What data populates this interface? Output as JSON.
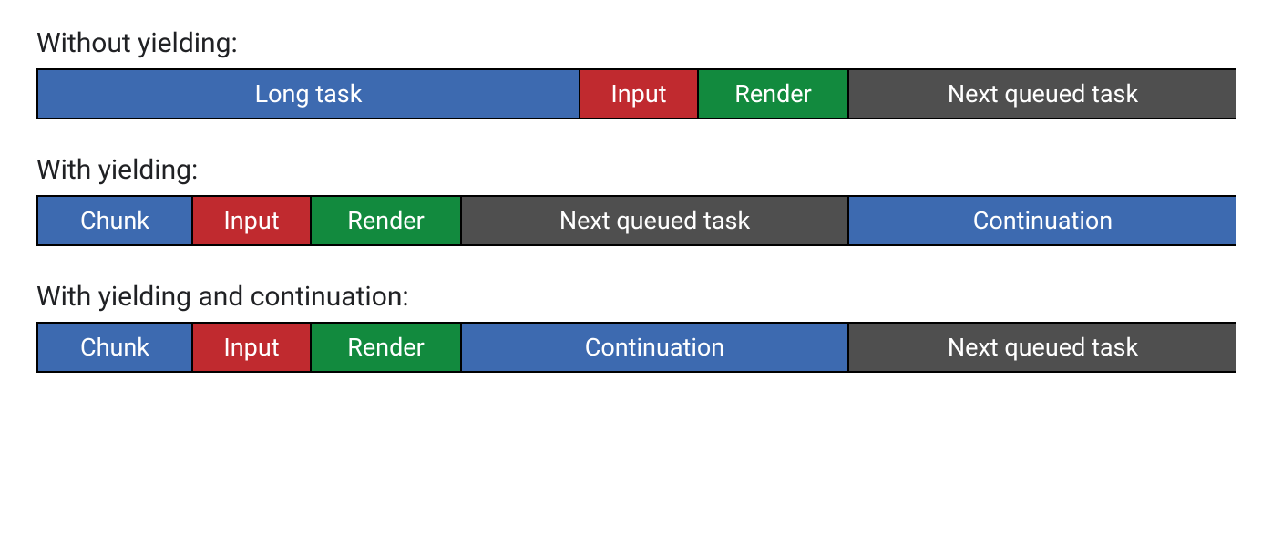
{
  "sections": [
    {
      "title": "Without yielding:",
      "segments": [
        {
          "label": "Long task",
          "color": "blue",
          "flex": 595
        },
        {
          "label": "Input",
          "color": "red",
          "flex": 130
        },
        {
          "label": "Render",
          "color": "green",
          "flex": 165
        },
        {
          "label": "Next queued task",
          "color": "gray",
          "flex": 425
        }
      ]
    },
    {
      "title": "With yielding:",
      "segments": [
        {
          "label": "Chunk",
          "color": "blue",
          "flex": 170
        },
        {
          "label": "Input",
          "color": "red",
          "flex": 130
        },
        {
          "label": "Render",
          "color": "green",
          "flex": 165
        },
        {
          "label": "Next queued task",
          "color": "gray",
          "flex": 425
        },
        {
          "label": "Continuation",
          "color": "blue",
          "flex": 425
        }
      ]
    },
    {
      "title": "With yielding and continuation:",
      "segments": [
        {
          "label": "Chunk",
          "color": "blue",
          "flex": 170
        },
        {
          "label": "Input",
          "color": "red",
          "flex": 130
        },
        {
          "label": "Render",
          "color": "green",
          "flex": 165
        },
        {
          "label": "Continuation",
          "color": "blue",
          "flex": 425
        },
        {
          "label": "Next queued task",
          "color": "gray",
          "flex": 425
        }
      ]
    }
  ]
}
